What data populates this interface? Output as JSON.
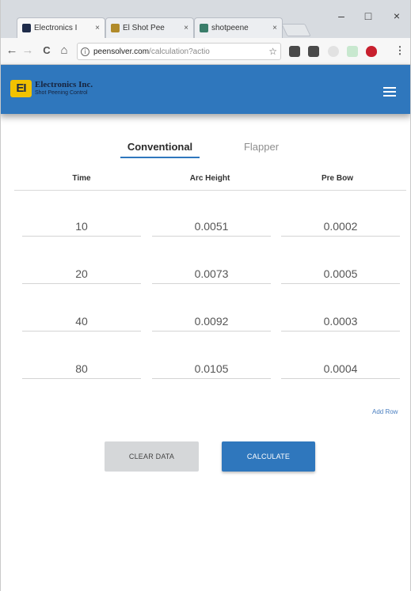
{
  "browser": {
    "tabs": [
      {
        "title": "Electronics I",
        "favicon_color": "#1f2c4a",
        "active": true
      },
      {
        "title": "El Shot Pee",
        "favicon_color": "#b08a2a",
        "active": false
      },
      {
        "title": "shotpeene",
        "favicon_color": "#3a7d6a",
        "active": false
      }
    ],
    "tab_close_glyph": "×",
    "window_controls": {
      "minimize": "–",
      "maximize": "□",
      "close": "×"
    },
    "nav": {
      "back": "←",
      "forward": "→",
      "reload": "C",
      "home": "⌂"
    },
    "address": {
      "host": "peensolver.com",
      "path": "/calculation?actio"
    },
    "extension_colors": [
      "#4a4a4a",
      "#4a4a4a",
      "#cfcfcf",
      "#9fd6a9",
      "#c8202e"
    ],
    "menu_glyph": "⋮"
  },
  "app": {
    "logo_text": "EI",
    "brand_name": "Electronics Inc.",
    "brand_sub": "Shot Peening Control",
    "accent": "#2f77bd",
    "logo_color": "#f2c200"
  },
  "mode_tabs": [
    {
      "label": "Conventional",
      "active": true
    },
    {
      "label": "Flapper",
      "active": false
    }
  ],
  "table": {
    "columns": [
      "Time",
      "Arc Height",
      "Pre Bow"
    ],
    "rows": [
      [
        "10",
        "0.0051",
        "0.0002"
      ],
      [
        "20",
        "0.0073",
        "0.0005"
      ],
      [
        "40",
        "0.0092",
        "0.0003"
      ],
      [
        "80",
        "0.0105",
        "0.0004"
      ]
    ]
  },
  "add_row_label": "Add Row",
  "buttons": {
    "clear": "CLEAR DATA",
    "calculate": "CALCULATE"
  }
}
